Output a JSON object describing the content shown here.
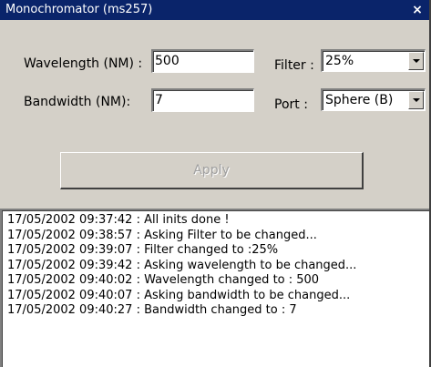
{
  "window": {
    "title": "Monochromator (ms257)",
    "close_glyph": "×"
  },
  "form": {
    "wavelength_label": "Wavelength (NM) :",
    "wavelength_value": "500",
    "bandwidth_label": "Bandwidth (NM):",
    "bandwidth_value": "7",
    "filter_label": "Filter :",
    "filter_value": "25%",
    "port_label": "Port :",
    "port_value": "Sphere (B)",
    "apply_label": "Apply"
  },
  "log": [
    "17/05/2002 09:37:42 : All inits done !",
    "17/05/2002 09:38:57 : Asking Filter to be changed...",
    "17/05/2002 09:39:07 : Filter changed to :25%",
    "17/05/2002 09:39:42 : Asking wavelength to be changed...",
    "17/05/2002 09:40:02 : Wavelength changed to : 500",
    "17/05/2002 09:40:07 : Asking bandwidth to be changed...",
    "17/05/2002 09:40:27 : Bandwidth changed to : 7"
  ]
}
